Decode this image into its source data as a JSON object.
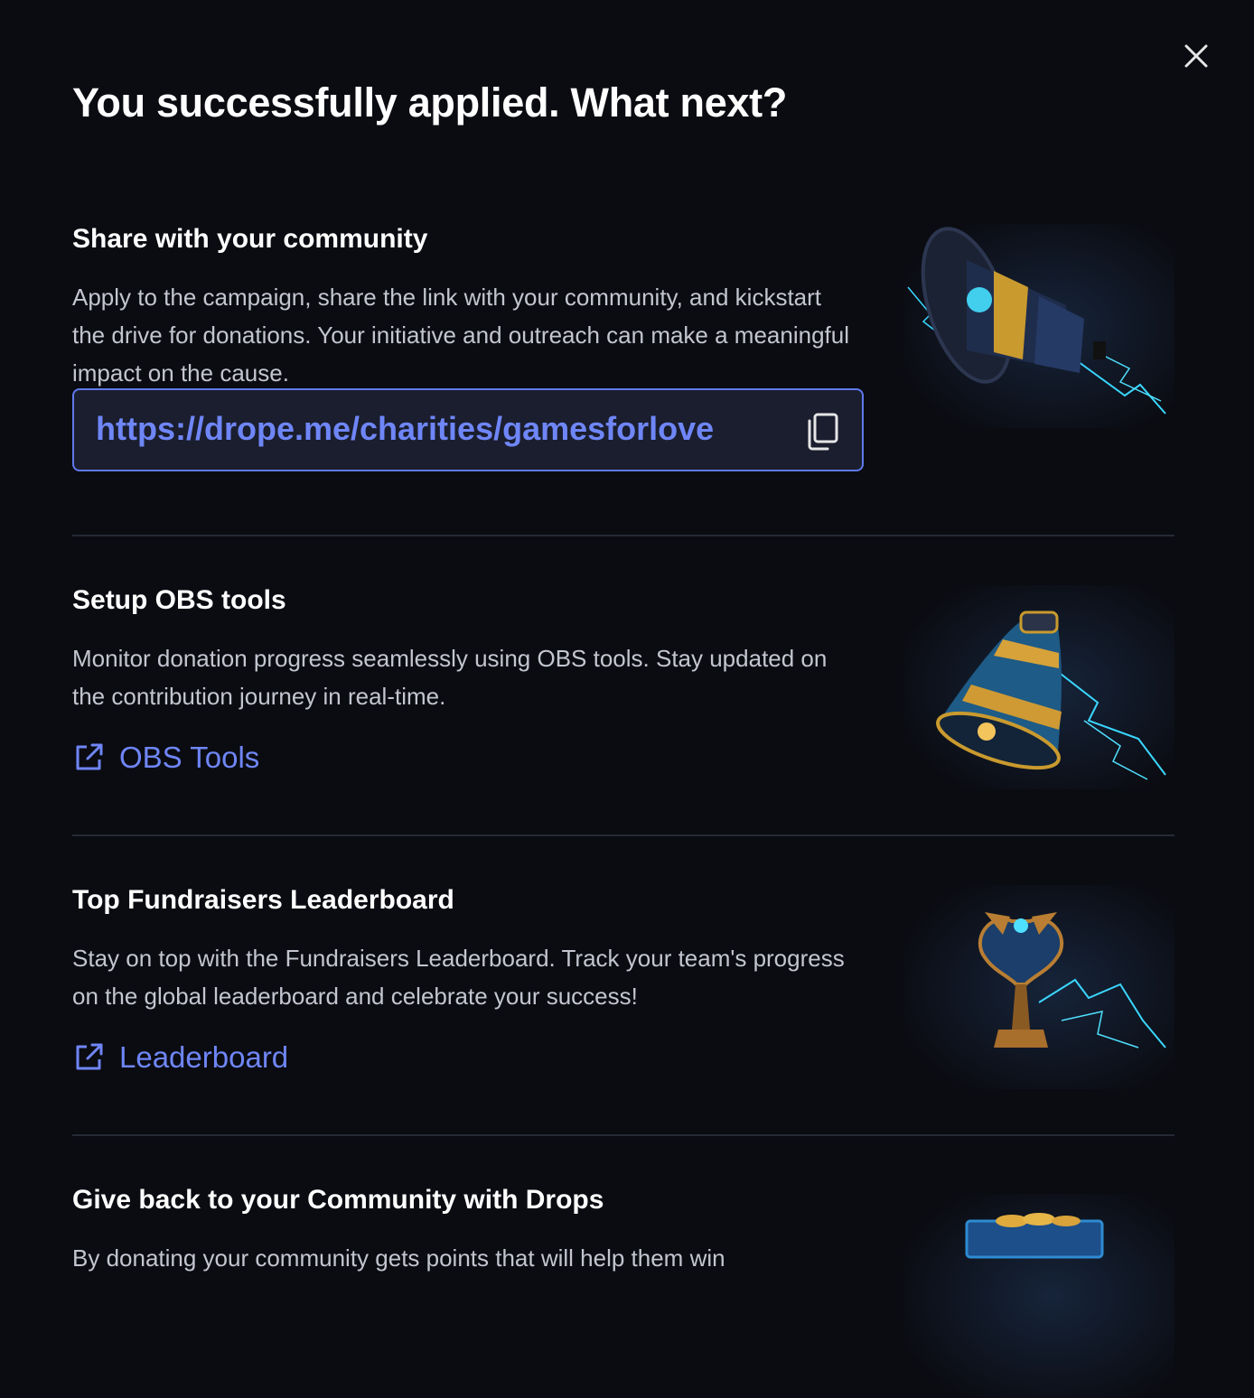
{
  "modal": {
    "title": "You successfully applied. What next?",
    "close_icon": "close-icon"
  },
  "sections": [
    {
      "heading": "Share with your community",
      "description": "Apply to the campaign, share the link with your community, and kickstart the drive for donations. Your initiative and outreach can make a meaningful impact on the cause.",
      "link_value": "https://drope.me/charities/gamesforlove",
      "copy_icon": "copy-icon",
      "image": "megaphone-illustration"
    },
    {
      "heading": "Setup OBS tools",
      "description": "Monitor donation progress seamlessly using OBS tools. Stay updated on the contribution journey in real-time.",
      "link_label": "OBS Tools",
      "link_icon": "external-link-icon",
      "image": "bell-illustration"
    },
    {
      "heading": "Top Fundraisers Leaderboard",
      "description": "Stay on top with the Fundraisers Leaderboard. Track your team's progress on the global leaderboard and celebrate your success!",
      "link_label": "Leaderboard",
      "link_icon": "external-link-icon",
      "image": "trophy-illustration"
    },
    {
      "heading": "Give back to your Community with Drops",
      "description": "By donating your community gets points that will help them win",
      "image": "treasure-illustration"
    }
  ],
  "colors": {
    "background": "#0b0c12",
    "accent": "#6f86f7",
    "divider": "#262a36",
    "body_text": "#c3c6cf"
  }
}
